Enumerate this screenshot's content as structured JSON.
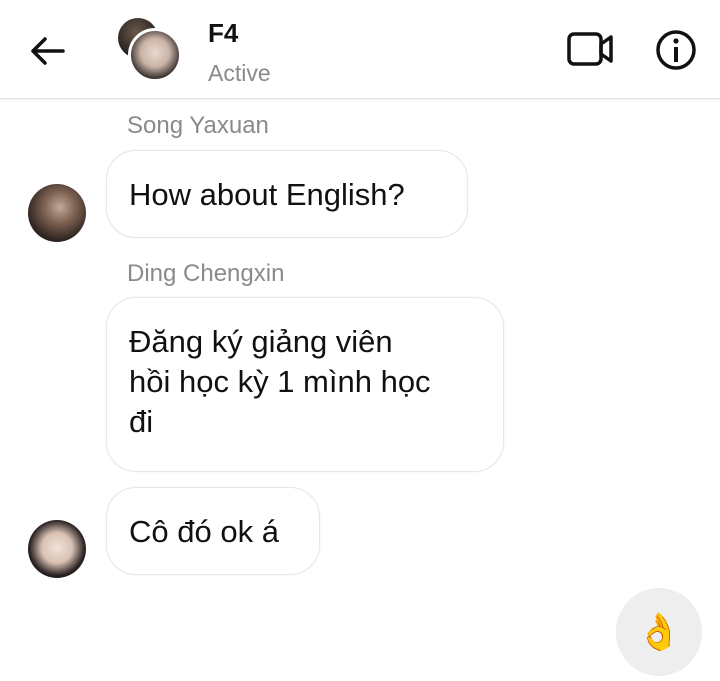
{
  "header": {
    "title": "F4",
    "status": "Active",
    "back_icon": "back-arrow-icon",
    "video_icon": "video-call-icon",
    "info_icon": "info-icon"
  },
  "messages": [
    {
      "sender": "Song Yaxuan",
      "text": "How about English?"
    },
    {
      "sender": "Ding Chengxin",
      "lines": [
        "Đăng ký giảng viên",
        "hồi học kỳ 1 mình học",
        "đi"
      ]
    },
    {
      "sender": "",
      "text": "Cô đó ok á"
    }
  ],
  "composer": {
    "reaction_icon": "ok-hand-icon",
    "reaction_glyph": "👌",
    "reaction_color": "#f6c21b"
  },
  "colors": {
    "header_bg": "#ffffff",
    "muted_text": "#8a8a8a",
    "bubble_border": "#e6e6e6"
  }
}
